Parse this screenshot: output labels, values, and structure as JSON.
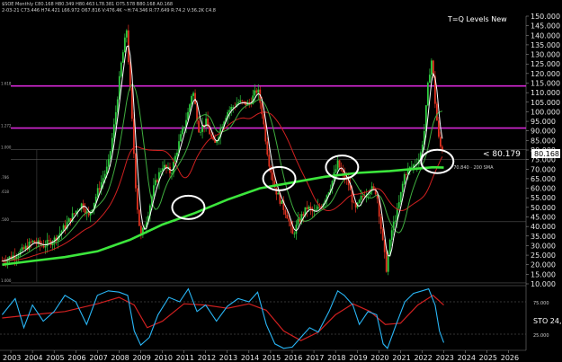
{
  "header": {
    "ticker_line": "$SOE Monthly  C80.168  H80.349  H80.463  L78.381  O75.578  B80.168  A0.168",
    "info_line": "2-03-21  C73.446  H74.421  L66.972  O67.816  V:476.4K  ~H:74.346  R:77.649  R:74.2  V:36.2K  C4.8"
  },
  "title_tag": "T=Q Levels New",
  "price_tag": "< 80.179",
  "last_price_label": "80.168",
  "sma_label": "~70.840 · 200 SMA",
  "fib_labels": [
    "1.618",
    "1.272",
    "1.000",
    ".786",
    ".618",
    ".500",
    "1.000"
  ],
  "sto_label": "STO 24,",
  "osc_ticks": [
    "25.000",
    "75.000"
  ],
  "colors": {
    "background": "#000000",
    "candle_up": "#2ecc40",
    "candle_down": "#e0311f",
    "fast_ma": "#ffffff",
    "sma_100": "#d02020",
    "sma_200": "#3ce63c",
    "sma_50": "#3fae3f",
    "fib_magenta": "#d628d6",
    "osc_main": "#29b6f6",
    "osc_signal": "#d02020",
    "circles": "#ffffff"
  },
  "chart_data": {
    "type": "candlestick",
    "title": "T=Q Levels New",
    "interval": "monthly",
    "y_range": [
      10,
      150
    ],
    "y_ticks": [
      10,
      15,
      20,
      25,
      30,
      35,
      40,
      45,
      50,
      55,
      60,
      65,
      70,
      75,
      80,
      85,
      90,
      95,
      100,
      105,
      110,
      115,
      120,
      125,
      130,
      135,
      140,
      145,
      150
    ],
    "x_ticks": [
      "2003",
      "2004",
      "2005",
      "2006",
      "2007",
      "2008",
      "2009",
      "2010",
      "2011",
      "2012",
      "2013",
      "2014",
      "2015",
      "2016",
      "2017",
      "2018",
      "2019",
      "2020",
      "2021",
      "2022",
      "2023",
      "2024",
      "2025",
      "2026"
    ],
    "x_range": [
      2002.5,
      2026.8
    ],
    "last_price": 80.168,
    "horizontal_levels": [
      {
        "value": 113.5,
        "label": "1.618",
        "color": "magenta"
      },
      {
        "value": 91.5,
        "label": "1.272",
        "color": "magenta"
      },
      {
        "value": 80.2,
        "label": "",
        "color": "gray"
      },
      {
        "value": 75.0,
        "label": ".786",
        "color": "gray"
      },
      {
        "value": 42.5,
        "label": ".500",
        "color": "gray"
      },
      {
        "value": 10.5,
        "label": "1.000",
        "color": "gray"
      }
    ],
    "price_path": [
      [
        2002.6,
        22
      ],
      [
        2003.0,
        24
      ],
      [
        2003.5,
        27
      ],
      [
        2004.0,
        32
      ],
      [
        2004.5,
        30
      ],
      [
        2005.0,
        33
      ],
      [
        2005.5,
        40
      ],
      [
        2006.0,
        48
      ],
      [
        2006.3,
        52
      ],
      [
        2006.6,
        45
      ],
      [
        2007.0,
        58
      ],
      [
        2007.5,
        72
      ],
      [
        2007.8,
        95
      ],
      [
        2008.1,
        125
      ],
      [
        2008.35,
        143
      ],
      [
        2008.6,
        95
      ],
      [
        2008.8,
        55
      ],
      [
        2009.0,
        34
      ],
      [
        2009.3,
        45
      ],
      [
        2009.6,
        60
      ],
      [
        2010.0,
        72
      ],
      [
        2010.4,
        68
      ],
      [
        2010.8,
        85
      ],
      [
        2011.2,
        100
      ],
      [
        2011.4,
        112
      ],
      [
        2011.7,
        90
      ],
      [
        2012.0,
        95
      ],
      [
        2012.4,
        82
      ],
      [
        2012.8,
        95
      ],
      [
        2013.0,
        100
      ],
      [
        2013.5,
        105
      ],
      [
        2014.0,
        104
      ],
      [
        2014.4,
        112
      ],
      [
        2014.6,
        100
      ],
      [
        2014.9,
        75
      ],
      [
        2015.2,
        60
      ],
      [
        2015.5,
        52
      ],
      [
        2015.8,
        45
      ],
      [
        2016.0,
        35
      ],
      [
        2016.3,
        43
      ],
      [
        2016.7,
        50
      ],
      [
        2017.0,
        47
      ],
      [
        2017.4,
        52
      ],
      [
        2017.8,
        62
      ],
      [
        2018.1,
        73
      ],
      [
        2018.3,
        68
      ],
      [
        2018.6,
        62
      ],
      [
        2018.9,
        48
      ],
      [
        2019.2,
        55
      ],
      [
        2019.6,
        60
      ],
      [
        2019.9,
        58
      ],
      [
        2020.2,
        30
      ],
      [
        2020.35,
        18
      ],
      [
        2020.6,
        38
      ],
      [
        2020.9,
        50
      ],
      [
        2021.2,
        68
      ],
      [
        2021.6,
        72
      ],
      [
        2021.9,
        76
      ],
      [
        2022.1,
        90
      ],
      [
        2022.3,
        118
      ],
      [
        2022.45,
        128
      ],
      [
        2022.6,
        105
      ],
      [
        2022.8,
        82
      ],
      [
        2023.0,
        80.2
      ]
    ],
    "sma_200_path": [
      [
        2002.6,
        20
      ],
      [
        2004.0,
        22
      ],
      [
        2005.5,
        24
      ],
      [
        2007.0,
        27
      ],
      [
        2008.5,
        33
      ],
      [
        2010.0,
        41
      ],
      [
        2011.5,
        47
      ],
      [
        2013.0,
        54
      ],
      [
        2014.5,
        60
      ],
      [
        2016.0,
        63
      ],
      [
        2017.5,
        66
      ],
      [
        2019.0,
        68
      ],
      [
        2020.5,
        69
      ],
      [
        2021.5,
        70
      ],
      [
        2022.5,
        71
      ],
      [
        2023.0,
        70.8
      ]
    ],
    "oscillator": {
      "name": "STO 24",
      "y_range": [
        0,
        100
      ],
      "levels": [
        25,
        75
      ],
      "main": [
        [
          2002.6,
          55
        ],
        [
          2003.2,
          80
        ],
        [
          2003.6,
          35
        ],
        [
          2004.0,
          70
        ],
        [
          2004.5,
          45
        ],
        [
          2005.0,
          60
        ],
        [
          2005.5,
          85
        ],
        [
          2006.0,
          75
        ],
        [
          2006.5,
          40
        ],
        [
          2007.0,
          85
        ],
        [
          2007.5,
          92
        ],
        [
          2008.0,
          90
        ],
        [
          2008.4,
          85
        ],
        [
          2008.7,
          30
        ],
        [
          2009.0,
          8
        ],
        [
          2009.4,
          20
        ],
        [
          2009.8,
          55
        ],
        [
          2010.3,
          82
        ],
        [
          2010.8,
          75
        ],
        [
          2011.2,
          95
        ],
        [
          2011.6,
          60
        ],
        [
          2012.0,
          70
        ],
        [
          2012.5,
          45
        ],
        [
          2013.0,
          68
        ],
        [
          2013.5,
          80
        ],
        [
          2014.0,
          75
        ],
        [
          2014.4,
          90
        ],
        [
          2014.8,
          40
        ],
        [
          2015.2,
          10
        ],
        [
          2015.6,
          3
        ],
        [
          2016.0,
          5
        ],
        [
          2016.4,
          20
        ],
        [
          2016.8,
          35
        ],
        [
          2017.2,
          28
        ],
        [
          2017.7,
          60
        ],
        [
          2018.1,
          92
        ],
        [
          2018.4,
          85
        ],
        [
          2018.8,
          70
        ],
        [
          2019.1,
          40
        ],
        [
          2019.5,
          60
        ],
        [
          2019.9,
          55
        ],
        [
          2020.2,
          10
        ],
        [
          2020.4,
          3
        ],
        [
          2020.8,
          40
        ],
        [
          2021.2,
          75
        ],
        [
          2021.6,
          88
        ],
        [
          2022.0,
          92
        ],
        [
          2022.3,
          95
        ],
        [
          2022.6,
          70
        ],
        [
          2022.8,
          30
        ],
        [
          2023.0,
          12
        ]
      ],
      "signal": [
        [
          2002.6,
          50
        ],
        [
          2004.0,
          55
        ],
        [
          2005.5,
          60
        ],
        [
          2007.0,
          72
        ],
        [
          2008.0,
          82
        ],
        [
          2008.7,
          70
        ],
        [
          2009.3,
          35
        ],
        [
          2010.0,
          45
        ],
        [
          2011.0,
          72
        ],
        [
          2012.0,
          70
        ],
        [
          2013.0,
          65
        ],
        [
          2014.0,
          72
        ],
        [
          2014.8,
          62
        ],
        [
          2015.6,
          30
        ],
        [
          2016.4,
          15
        ],
        [
          2017.2,
          28
        ],
        [
          2018.0,
          55
        ],
        [
          2018.8,
          72
        ],
        [
          2019.6,
          60
        ],
        [
          2020.3,
          40
        ],
        [
          2021.0,
          42
        ],
        [
          2021.8,
          70
        ],
        [
          2022.5,
          85
        ],
        [
          2023.0,
          70
        ]
      ]
    },
    "annotations": [
      {
        "type": "ellipse",
        "x": 2011.2,
        "y": 50
      },
      {
        "type": "ellipse",
        "x": 2015.4,
        "y": 65
      },
      {
        "type": "ellipse",
        "x": 2018.3,
        "y": 71
      },
      {
        "type": "ellipse",
        "x": 2022.7,
        "y": 74
      }
    ]
  }
}
